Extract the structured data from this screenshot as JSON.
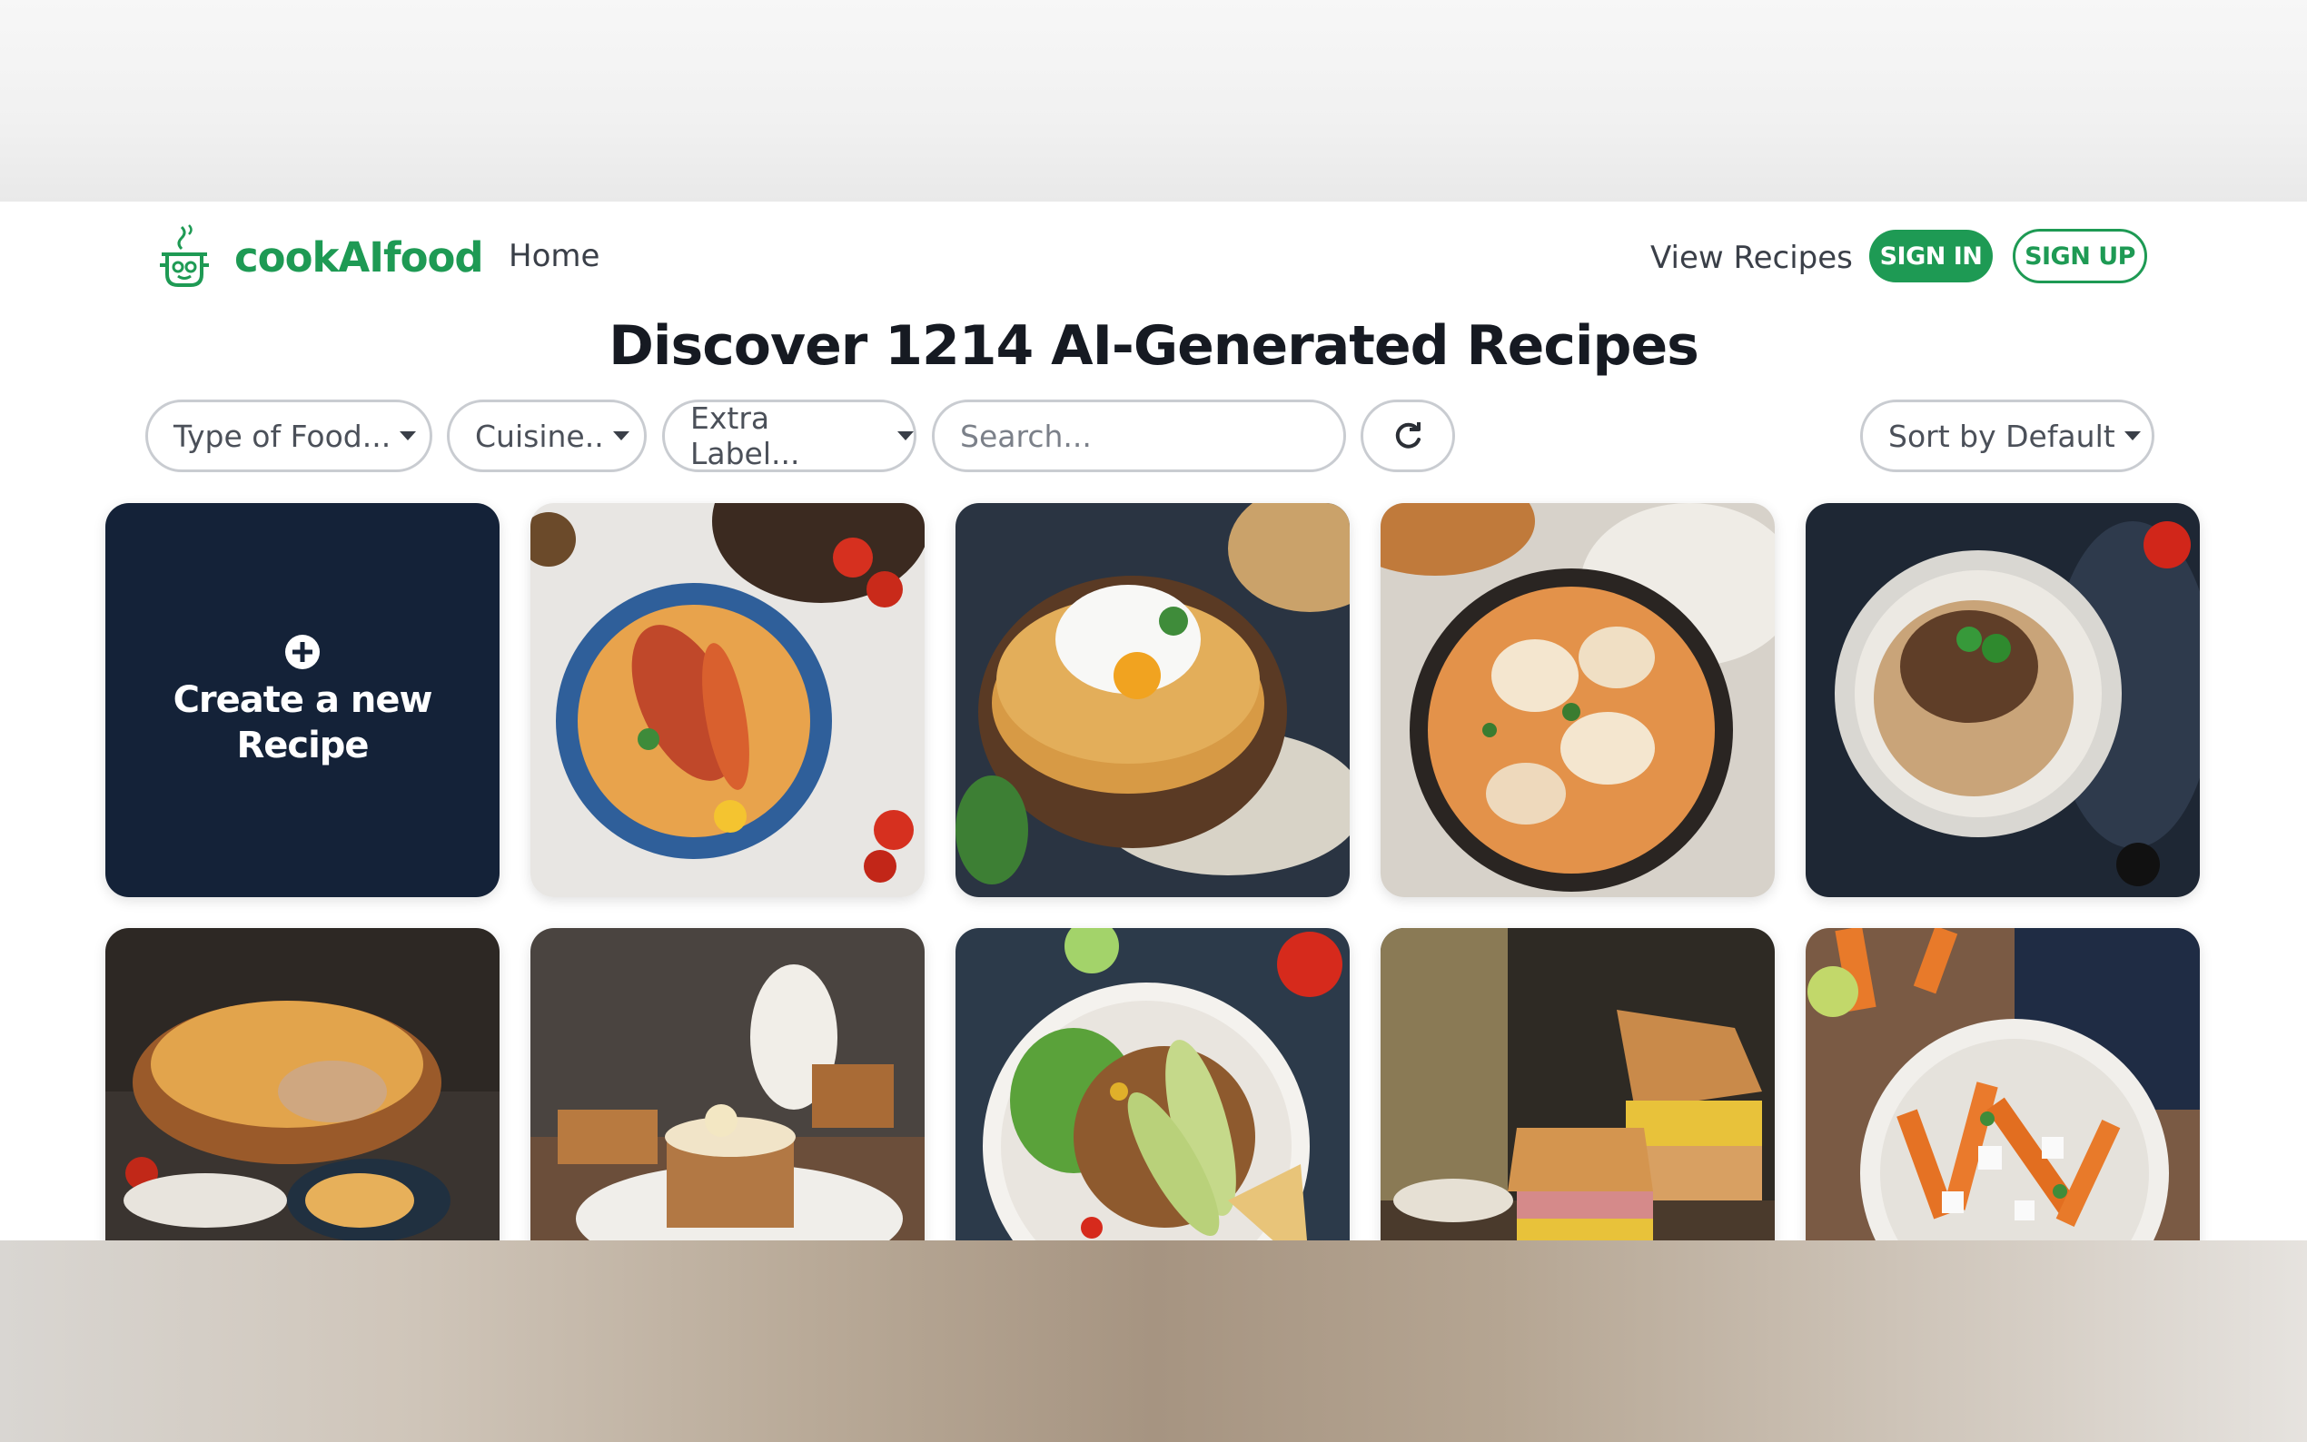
{
  "app": {
    "name": "cookAIfood"
  },
  "nav": {
    "home": "Home",
    "view_recipes": "View Recipes",
    "sign_in": "SIGN IN",
    "sign_up": "SIGN UP"
  },
  "headline": "Discover 1214 AI-Generated Recipes",
  "filters": {
    "type_of_food": "Type of Food...",
    "cuisine": "Cuisine..",
    "extra_label": "Extra Label...",
    "search_placeholder": "Search...",
    "sort": "Sort by Default"
  },
  "create_tile": {
    "label": "Create a new Recipe"
  },
  "colors": {
    "brand_green": "#1e9a54",
    "create_tile_bg": "#142238"
  },
  "icons": [
    "chef-robot-logo-icon",
    "caret-down-icon",
    "refresh-icon",
    "plus-circle-icon"
  ],
  "recipe_images": [
    "seafood-curry-bowl",
    "pancakes-with-poached-egg",
    "penne-chicken-skillet",
    "beef-noodles-with-basil",
    "savory-pie",
    "banana-cake-slice",
    "bean-avocado-salad",
    "ham-cheese-sandwich",
    "carrot-feta-salad"
  ]
}
